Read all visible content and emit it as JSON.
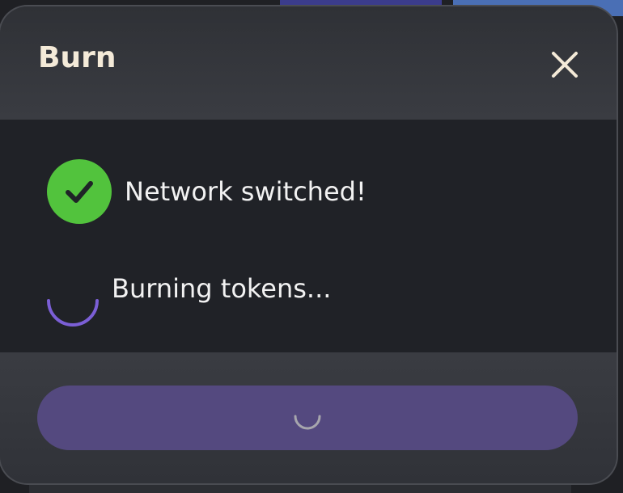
{
  "modal": {
    "title": "Burn",
    "close_icon": "close-icon"
  },
  "steps": [
    {
      "label": "Network switched!",
      "status": "complete",
      "icon": "check-circle-icon",
      "color": "#52c33d"
    },
    {
      "label": "Burning tokens...",
      "status": "in-progress",
      "icon": "spinner-icon",
      "color": "#7b5fd6"
    }
  ],
  "footer": {
    "button_state": "loading",
    "button_icon": "spinner-icon",
    "button_color": "#54497f"
  }
}
